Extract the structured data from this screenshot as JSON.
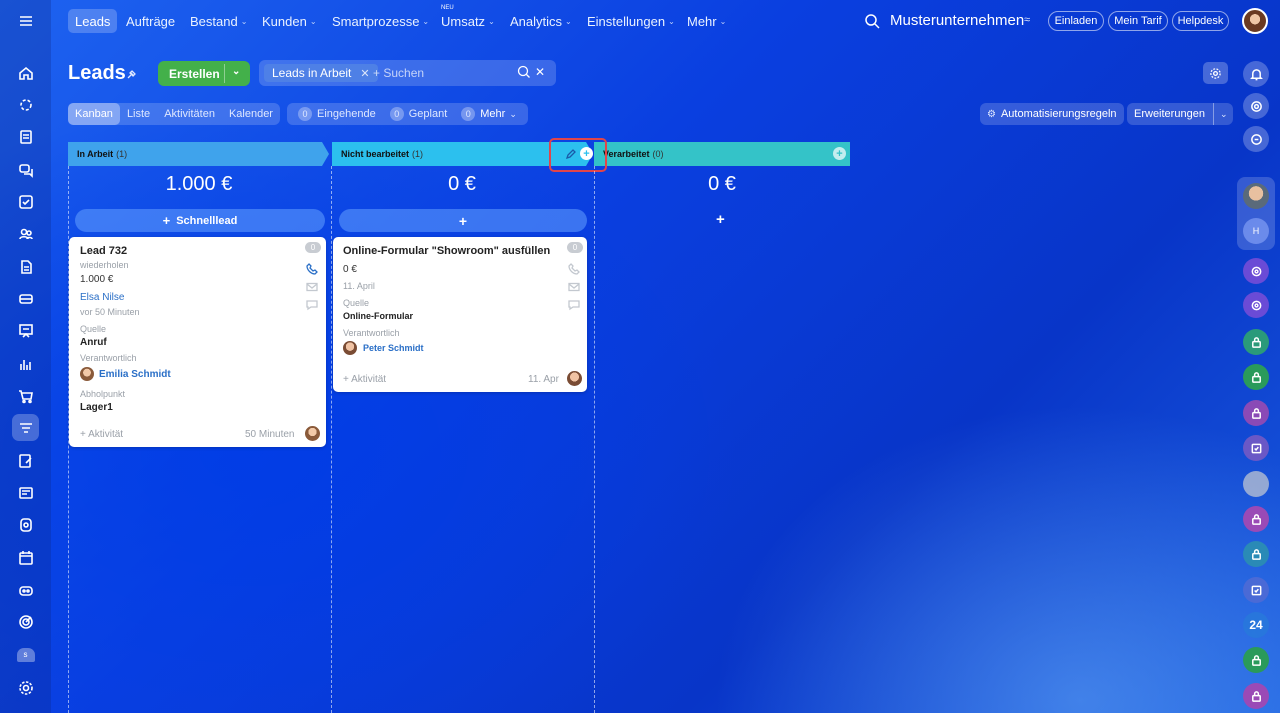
{
  "topnav": {
    "items": [
      "Leads",
      "Aufträge",
      "Bestand",
      "Kunden",
      "Smartprozesse",
      "Umsatz",
      "Analytics",
      "Einstellungen",
      "Mehr"
    ],
    "new_badge": "NEU",
    "company": "Musterunternehmen",
    "invite": "Einladen",
    "tariff": "Mein Tarif",
    "helpdesk": "Helpdesk"
  },
  "page": {
    "title": "Leads",
    "create_label": "Erstellen",
    "filter_chip": "Leads in Arbeit",
    "search_placeholder": "+ Suchen"
  },
  "views": {
    "kanban": "Kanban",
    "liste": "Liste",
    "aktivitaeten": "Aktivitäten",
    "kalender": "Kalender"
  },
  "counters": {
    "eingehende": {
      "count": "0",
      "label": "Eingehende"
    },
    "geplant": {
      "count": "0",
      "label": "Geplant"
    },
    "mehr": {
      "count": "0",
      "label": "Mehr"
    }
  },
  "actions": {
    "automation": "Automatisierungsregeln",
    "extensions": "Erweiterungen"
  },
  "columns": [
    {
      "title": "In Arbeit",
      "count": "(1)",
      "sum": "1.000 €",
      "add_label": "Schnelllead",
      "color": "#3fa3ec"
    },
    {
      "title": "Nicht bearbeitet",
      "count": "(1)",
      "sum": "0 €",
      "add_label": "",
      "color": "#2cc0ee"
    },
    {
      "title": "Verarbeitet",
      "count": "(0)",
      "sum": "0 €",
      "add_label": "",
      "color": "#34c3c8"
    }
  ],
  "cards": {
    "c1": {
      "title": "Lead 732",
      "sub": "wiederholen",
      "amount": "1.000 €",
      "contact": "Elsa Nilse",
      "time": "vor 50 Minuten",
      "source_label": "Quelle",
      "source": "Anruf",
      "resp_label": "Verantwortlich",
      "resp": "Emilia Schmidt",
      "pickup_label": "Abholpunkt",
      "pickup": "Lager1",
      "activity": "+ Aktivität",
      "footer_time": "50 Minuten",
      "badge": "0"
    },
    "c2": {
      "title": "Online-Formular \"Showroom\" ausfüllen",
      "amount": "0 €",
      "date": "11. April",
      "source_label": "Quelle",
      "source": "Online-Formular",
      "resp_label": "Verantwortlich",
      "resp": "Peter Schmidt",
      "activity": "+ Aktivität",
      "footer_time": "11. Apr",
      "badge": "0"
    }
  },
  "right_sidebar": {
    "counter": "24"
  },
  "colors": {
    "green": "#43b04a",
    "highlight": "#e0454a",
    "link": "#2a6fc7"
  }
}
